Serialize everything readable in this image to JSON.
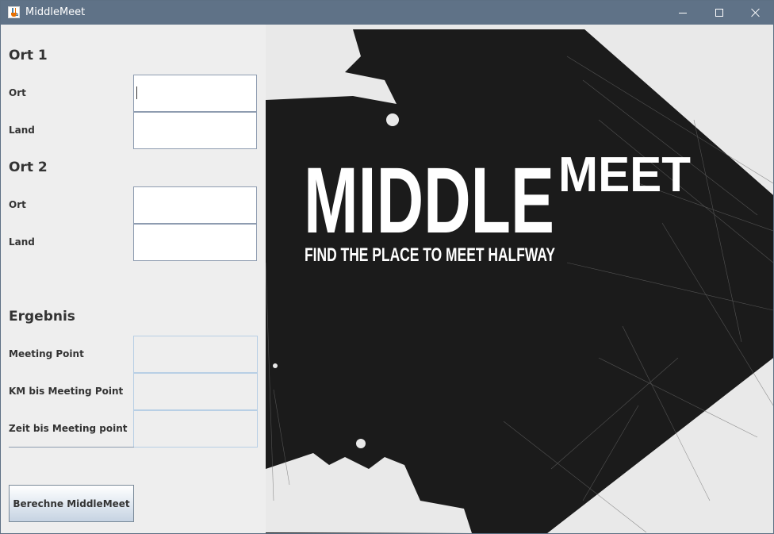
{
  "window": {
    "title": "MiddleMeet"
  },
  "form": {
    "location1": {
      "heading": "Ort 1",
      "city_label": "Ort",
      "city_value": "",
      "country_label": "Land",
      "country_value": ""
    },
    "location2": {
      "heading": "Ort 2",
      "city_label": "Ort",
      "city_value": "",
      "country_label": "Land",
      "country_value": ""
    },
    "result": {
      "heading": "Ergebnis",
      "meeting_point_label": "Meeting Point",
      "meeting_point_value": "",
      "km_label": "KM bis Meeting Point",
      "km_value": "",
      "time_label": "Zeit bis Meeting point",
      "time_value": ""
    },
    "calculate_button": "Berechne MiddleMeet"
  },
  "banner": {
    "logo_word1": "MIDDLE",
    "logo_word2": "MEET",
    "tagline": "FIND THE PLACE TO MEET HALFWAY"
  },
  "colors": {
    "titlebar": "#5f7287",
    "form_background": "#eeeeee",
    "banner_dark": "#1c1c1c",
    "banner_light": "#e8e8e8"
  }
}
